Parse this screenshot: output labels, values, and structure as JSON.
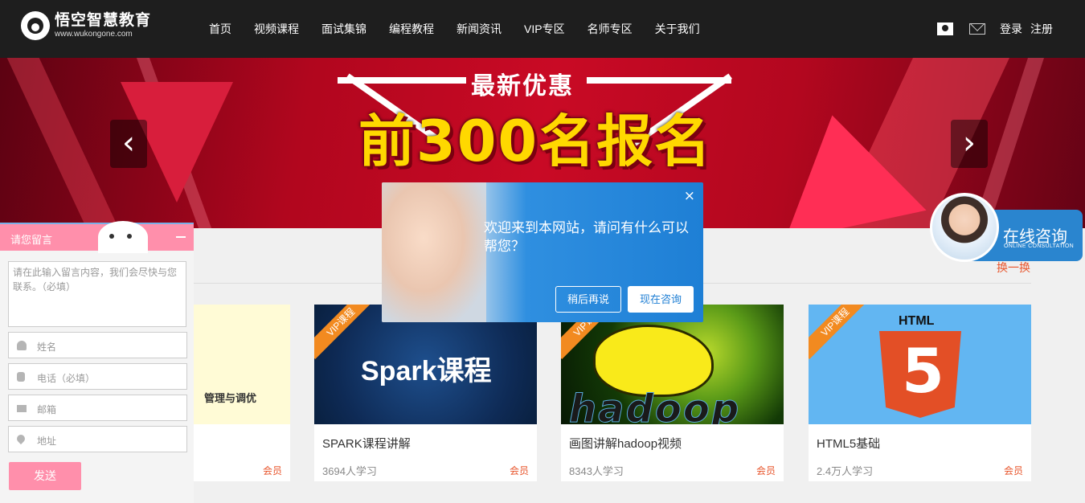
{
  "header": {
    "logo_title": "悟空智慧教育",
    "logo_url": "www.wukongone.com",
    "nav": [
      "首页",
      "视频课程",
      "面试集锦",
      "编程教程",
      "新闻资讯",
      "VIP专区",
      "名师专区",
      "关于我们"
    ],
    "login": "登录",
    "register": "注册"
  },
  "banner": {
    "subtitle": "最新优惠",
    "title": "前300名报名",
    "prev_icon": "chevron-left-icon",
    "next_icon": "chevron-right-icon"
  },
  "section": {
    "refresh_label": "换一换"
  },
  "courses": [
    {
      "thumb_text": "管理与调优",
      "title": "",
      "count": "",
      "badge": "会员"
    },
    {
      "thumb_text": "Spark课程",
      "vip": "VIP课程",
      "title": "SPARK课程讲解",
      "count": "3694人学习",
      "badge": "会员"
    },
    {
      "thumb_text": "hadoop",
      "vip": "VIP课程",
      "title": "画图讲解hadoop视频",
      "count": "8343人学习",
      "badge": "会员"
    },
    {
      "thumb_text": "5",
      "html_label": "HTML",
      "vip": "VIP课程",
      "title": "HTML5基础",
      "count": "2.4万人学习",
      "badge": "会员"
    }
  ],
  "chat_popup": {
    "message": "欢迎来到本网站，请问有什么可以帮您？",
    "later_label": "稍后再说",
    "now_label": "现在咨询",
    "close": "×"
  },
  "consult": {
    "title": "在线咨询",
    "subtitle": "ONLINE CONSULTATION"
  },
  "message_form": {
    "title": "请您留言",
    "content_placeholder": "请在此输入留言内容，我们会尽快与您联系。（必填）",
    "name_placeholder": "姓名",
    "phone_placeholder": "电话（必填）",
    "email_placeholder": "邮箱",
    "address_placeholder": "地址",
    "send_label": "发送"
  }
}
